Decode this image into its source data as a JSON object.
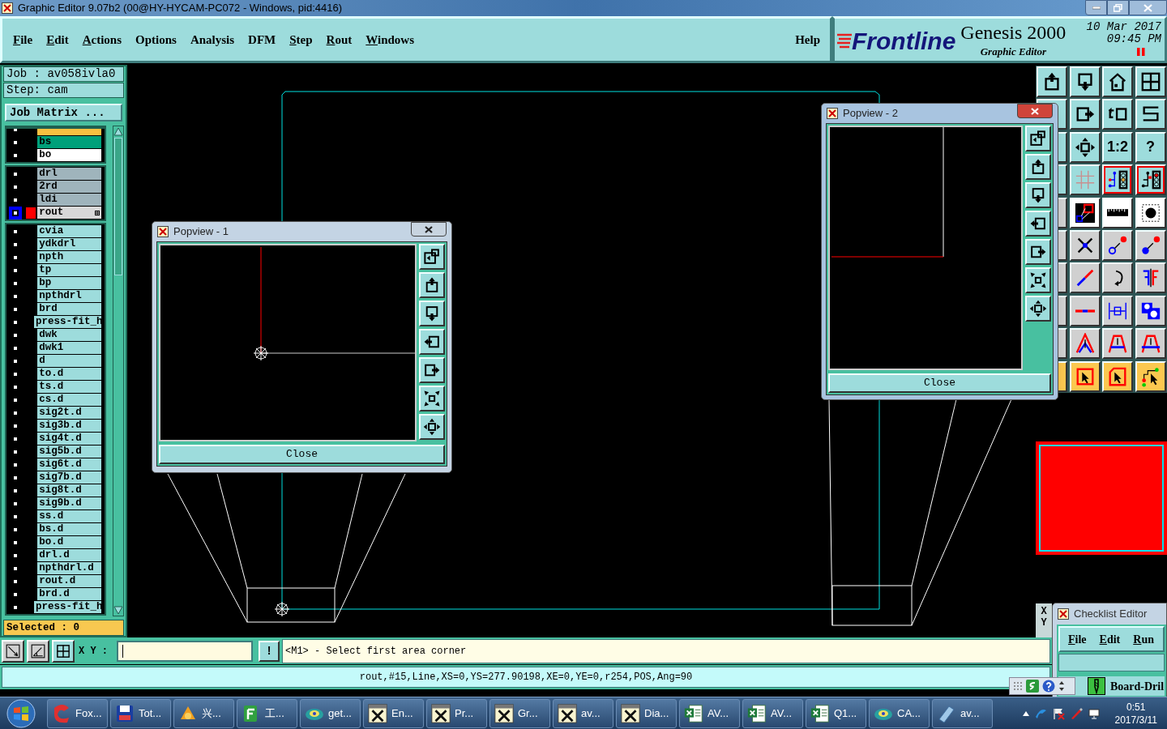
{
  "window": {
    "title": "Graphic Editor 9.07b2 (00@HY-HYCAM-PC072 - Windows, pid:4416)"
  },
  "menu": [
    {
      "label": "File",
      "underlined": true
    },
    {
      "label": "Edit",
      "underlined": true
    },
    {
      "label": "Actions",
      "underlined": true
    },
    {
      "label": "Options",
      "underlined": false
    },
    {
      "label": "Analysis",
      "underlined": false
    },
    {
      "label": "DFM",
      "underlined": false
    },
    {
      "label": "Step",
      "underlined": true
    },
    {
      "label": "Rout",
      "underlined": true
    },
    {
      "label": "Windows",
      "underlined": true
    }
  ],
  "help": "Help",
  "brand": {
    "logo": "Frontline",
    "product": "Genesis 2000",
    "subtitle": "Graphic Editor",
    "date": "10 Mar 2017",
    "time": "09:45 PM"
  },
  "job": {
    "job": "Job : av058ivla0",
    "step": "Step: cam",
    "matrix_button": "Job Matrix ..."
  },
  "layer_groups": [
    [
      {
        "color": "#f8c040",
        "selected": false
      },
      {
        "name": "bs",
        "color": "#00a07a",
        "selected": false
      },
      {
        "name": "bo",
        "color": "#ffffff",
        "selected": false
      }
    ],
    [
      {
        "name": "drl",
        "color": "#9fb4bc",
        "selected": false
      },
      {
        "name": "2rd",
        "color": "#9fb4bc",
        "selected": false
      },
      {
        "name": "ldi",
        "color": "#9fb4bc",
        "selected": false
      },
      {
        "name": "rout",
        "color": "#d8d8d8",
        "selected": true
      }
    ],
    [
      {
        "name": "cvia",
        "color": "#9ddcdc",
        "selected": false
      },
      {
        "name": "ydkdrl",
        "color": "#9ddcdc",
        "selected": false
      },
      {
        "name": "npth",
        "color": "#9ddcdc",
        "selected": false
      },
      {
        "name": "tp",
        "color": "#9ddcdc",
        "selected": false
      },
      {
        "name": "bp",
        "color": "#9ddcdc",
        "selected": false
      },
      {
        "name": "npthdrl",
        "color": "#9ddcdc",
        "selected": false
      },
      {
        "name": "brd",
        "color": "#9ddcdc",
        "selected": false
      },
      {
        "name": "press-fit_h",
        "color": "#9ddcdc",
        "selected": false
      },
      {
        "name": "dwk",
        "color": "#9ddcdc",
        "selected": false
      },
      {
        "name": "dwk1",
        "color": "#9ddcdc",
        "selected": false
      },
      {
        "name": "d",
        "color": "#9ddcdc",
        "selected": false
      },
      {
        "name": "to.d",
        "color": "#9ddcdc",
        "selected": false
      },
      {
        "name": "ts.d",
        "color": "#9ddcdc",
        "selected": false
      },
      {
        "name": "cs.d",
        "color": "#9ddcdc",
        "selected": false
      },
      {
        "name": "sig2t.d",
        "color": "#9ddcdc",
        "selected": false
      },
      {
        "name": "sig3b.d",
        "color": "#9ddcdc",
        "selected": false
      },
      {
        "name": "sig4t.d",
        "color": "#9ddcdc",
        "selected": false
      },
      {
        "name": "sig5b.d",
        "color": "#9ddcdc",
        "selected": false
      },
      {
        "name": "sig6t.d",
        "color": "#9ddcdc",
        "selected": false
      },
      {
        "name": "sig7b.d",
        "color": "#9ddcdc",
        "selected": false
      },
      {
        "name": "sig8t.d",
        "color": "#9ddcdc",
        "selected": false
      },
      {
        "name": "sig9b.d",
        "color": "#9ddcdc",
        "selected": false
      },
      {
        "name": "ss.d",
        "color": "#9ddcdc",
        "selected": false
      },
      {
        "name": "bs.d",
        "color": "#9ddcdc",
        "selected": false
      },
      {
        "name": "bo.d",
        "color": "#9ddcdc",
        "selected": false
      },
      {
        "name": "drl.d",
        "color": "#9ddcdc",
        "selected": false
      },
      {
        "name": "npthdrl.d",
        "color": "#9ddcdc",
        "selected": false
      },
      {
        "name": "rout.d",
        "color": "#9ddcdc",
        "selected": false
      },
      {
        "name": "brd.d",
        "color": "#9ddcdc",
        "selected": false
      },
      {
        "name": "press-fit_h",
        "color": "#9ddcdc",
        "selected": false
      }
    ]
  ],
  "selected_count": "Selected : 0",
  "toolbar": {
    "scale_label": "1:2",
    "help_label": "?"
  },
  "popviews": [
    {
      "title": "Popview - 1",
      "close": "Close",
      "active": false
    },
    {
      "title": "Popview - 2",
      "close": "Close",
      "active": true
    }
  ],
  "coord_labels": [
    "X",
    "Y"
  ],
  "command": {
    "label": "X Y :",
    "bang": "!",
    "prompt": "<M1> - Select first area corner"
  },
  "status_line": "rout,#15,Line,XS=0,YS=277.90198,XE=0,YE=0,r254,POS,Ang=90",
  "checklist": {
    "title": "Checklist Editor",
    "menu": [
      {
        "label": "File",
        "underlined": true
      },
      {
        "label": "Edit",
        "underlined": true
      },
      {
        "label": "Run",
        "underlined": true
      }
    ],
    "item": "Board-Dril"
  },
  "taskbar": {
    "items": [
      "Fox...",
      "Tot...",
      "兴...",
      "工...",
      "get...",
      "En...",
      "Pr...",
      "Gr...",
      "av...",
      "Dia...",
      "AV...",
      "AV...",
      "Q1...",
      "CA...",
      "av..."
    ],
    "time": "0:51",
    "date": "2017/3/11"
  }
}
